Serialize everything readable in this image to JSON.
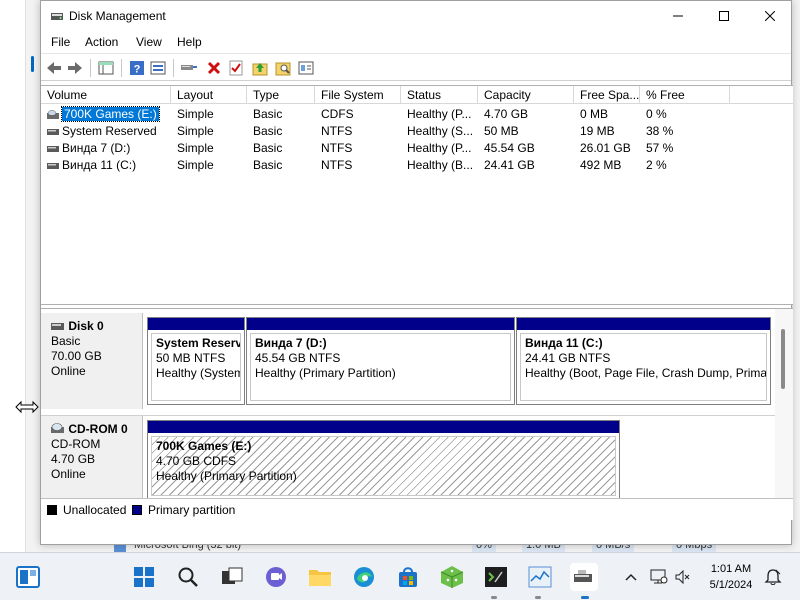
{
  "window": {
    "title": "Disk Management"
  },
  "menu": [
    "File",
    "Action",
    "View",
    "Help"
  ],
  "colors": {
    "primary_partition": "#00008b",
    "unallocated": "#000000",
    "selection": "#0078d7"
  },
  "volume_list": {
    "columns": [
      "Volume",
      "Layout",
      "Type",
      "File System",
      "Status",
      "Capacity",
      "Free Spa...",
      "% Free"
    ],
    "rows": [
      {
        "volume": "700K Games (E:)",
        "layout": "Simple",
        "type": "Basic",
        "fs": "CDFS",
        "status": "Healthy (P...",
        "capacity": "4.70 GB",
        "free": "0 MB",
        "pct": "0 %",
        "selected": true,
        "icon": "cdrom-volume-icon"
      },
      {
        "volume": "System Reserved",
        "layout": "Simple",
        "type": "Basic",
        "fs": "NTFS",
        "status": "Healthy (S...",
        "capacity": "50 MB",
        "free": "19 MB",
        "pct": "38 %",
        "selected": false,
        "icon": "disk-volume-icon"
      },
      {
        "volume": "Винда 7 (D:)",
        "layout": "Simple",
        "type": "Basic",
        "fs": "NTFS",
        "status": "Healthy (P...",
        "capacity": "45.54 GB",
        "free": "26.01 GB",
        "pct": "57 %",
        "selected": false,
        "icon": "disk-volume-icon"
      },
      {
        "volume": "Винда 11 (C:)",
        "layout": "Simple",
        "type": "Basic",
        "fs": "NTFS",
        "status": "Healthy (B...",
        "capacity": "24.41 GB",
        "free": "492 MB",
        "pct": "2 %",
        "selected": false,
        "icon": "disk-volume-icon"
      }
    ]
  },
  "disks": [
    {
      "name": "Disk 0",
      "type": "Basic",
      "size": "70.00 GB",
      "state": "Online",
      "icon": "hard-disk-icon",
      "partitions": [
        {
          "name": "System Reserve",
          "size_fs": "50 MB NTFS",
          "status": "Healthy (System"
        },
        {
          "name": "Винда 7  (D:)",
          "size_fs": "45.54 GB NTFS",
          "status": "Healthy (Primary Partition)"
        },
        {
          "name": "Винда 11  (C:)",
          "size_fs": "24.41 GB NTFS",
          "status": "Healthy (Boot, Page File, Crash Dump, Primar"
        }
      ]
    },
    {
      "name": "CD-ROM 0",
      "type": "CD-ROM",
      "size": "4.70 GB",
      "state": "Online",
      "icon": "cdrom-icon",
      "partitions": [
        {
          "name": "700K Games  (E:)",
          "size_fs": "4.70 GB CDFS",
          "status": "Healthy (Primary Partition)"
        }
      ]
    }
  ],
  "legend": [
    {
      "label": "Unallocated",
      "color": "#000000"
    },
    {
      "label": "Primary partition",
      "color": "#00008b"
    }
  ],
  "background_window": {
    "row_text": "Microsoft Bing (32 bit)",
    "cells": [
      "0%",
      "1.0 MB",
      "0 MB/s",
      "0 Mbps"
    ]
  },
  "taskbar": {
    "icons": [
      "widgets-icon",
      "start-icon",
      "search-icon",
      "task-view-icon",
      "chat-icon",
      "file-explorer-icon",
      "edge-icon",
      "store-icon",
      "game-icon",
      "terminal-icon",
      "task-manager-icon",
      "disk-management-icon"
    ],
    "time": "1:01 AM",
    "date": "5/1/2024"
  }
}
